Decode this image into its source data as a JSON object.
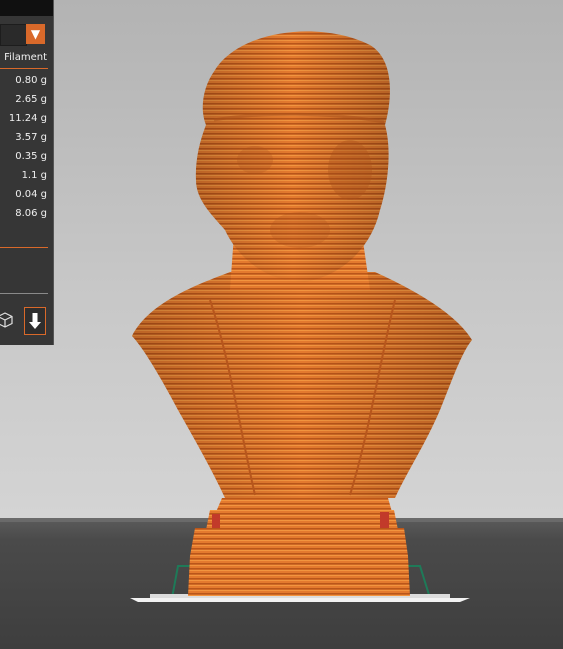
{
  "panel": {
    "header_text": "Filament",
    "rows": [
      "0.80 g",
      "2.65 g",
      "11.24 g",
      "3.57 g",
      "0.35 g",
      "1.1 g",
      "0.04 g",
      "8.06 g"
    ],
    "dropdown_arrow": "▼"
  },
  "icons": {
    "view": "cube-outline-icon",
    "export": "export-down-icon"
  },
  "colors": {
    "accent": "#d9692a",
    "model": "#e0762c",
    "panel_bg": "#363636"
  }
}
